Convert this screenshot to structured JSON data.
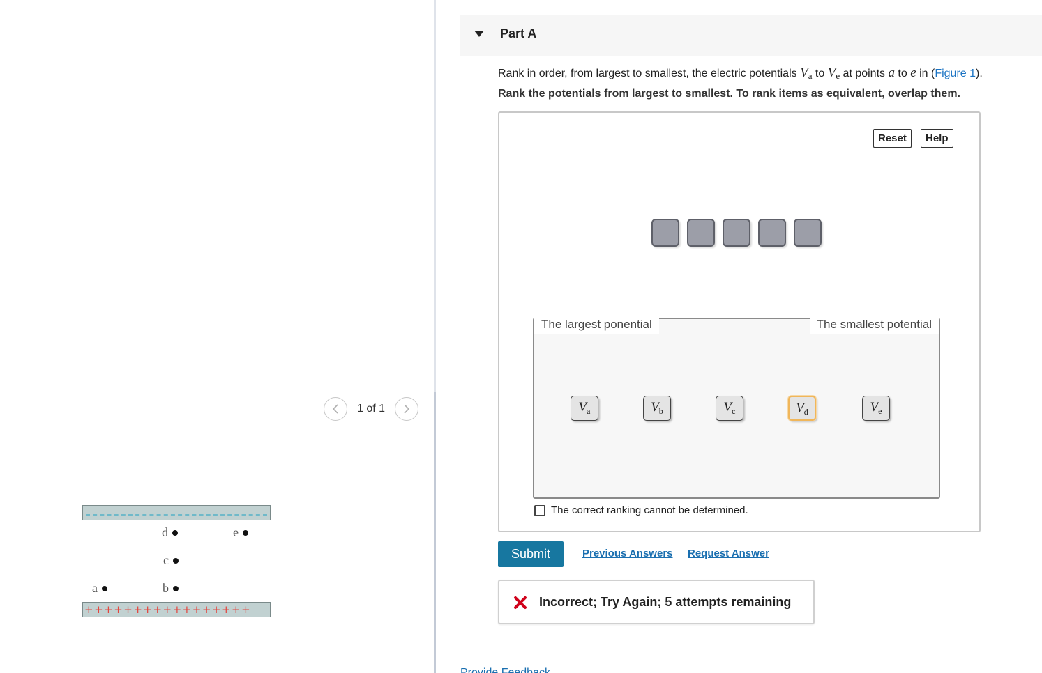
{
  "pager": {
    "text": "1 of 1"
  },
  "figure": {
    "plus_signs": "+++++++++++++++++",
    "points": {
      "a": "a",
      "b": "b",
      "c": "c",
      "d": "d",
      "e": "e"
    },
    "colors": {
      "plate": "#c1d1d1",
      "negative_dash": "#6fb9c9",
      "positive_sign": "#e2463f"
    }
  },
  "part": {
    "title": "Part A"
  },
  "question": {
    "t1": "Rank in order, from largest to smallest, the electric potentials ",
    "v_first": {
      "sym": "V",
      "sub": "a"
    },
    "t2": " to ",
    "v_last": {
      "sym": "V",
      "sub": "e"
    },
    "t3": " at points ",
    "p_first": "a",
    "t4": " to ",
    "p_last": "e",
    "t5": " in (",
    "figure_link": "Figure 1",
    "t6": ").",
    "instruction": "Rank the potentials from largest to smallest. To rank items as equivalent, overlap them."
  },
  "widget": {
    "reset_label": "Reset",
    "help_label": "Help",
    "largest_label": "The largest ponential",
    "smallest_label": "The smallest potential",
    "items": [
      {
        "sym": "V",
        "sub": "a"
      },
      {
        "sym": "V",
        "sub": "b"
      },
      {
        "sym": "V",
        "sub": "c"
      },
      {
        "sym": "V",
        "sub": "d"
      },
      {
        "sym": "V",
        "sub": "e"
      }
    ],
    "cannot_label": "The correct ranking cannot be determined."
  },
  "actions": {
    "submit_label": "Submit",
    "previous_answers": "Previous Answers",
    "request_answer": "Request Answer"
  },
  "feedback": {
    "message": "Incorrect; Try Again; 5 attempts remaining",
    "icon": "close-icon",
    "icon_color": "#d0021b"
  },
  "footer": {
    "provide_feedback": "Provide Feedback"
  },
  "colors": {
    "submit": "#1777a0",
    "link": "#1a6fb0",
    "slot": "#9c9ea8"
  }
}
